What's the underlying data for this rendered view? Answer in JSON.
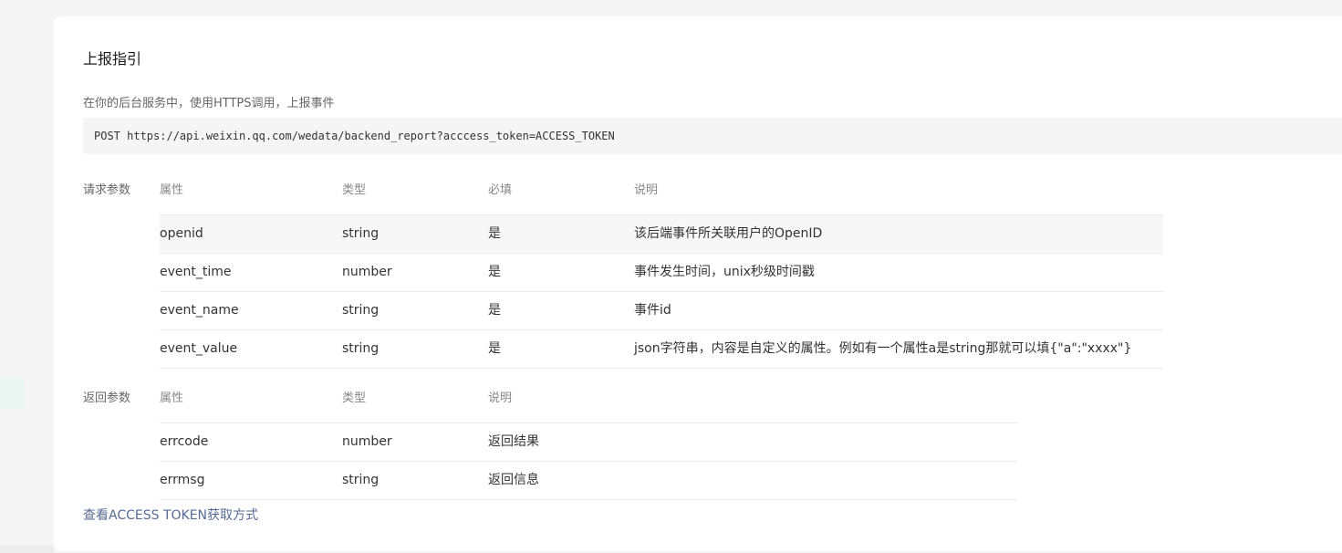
{
  "section_title": "上报指引",
  "description": "在你的后台服务中，使用HTTPS调用，上报事件",
  "request_line": "POST https://api.weixin.qq.com/wedata/backend_report?acccess_token=ACCESS_TOKEN",
  "request_params": {
    "label": "请求参数",
    "headers": [
      "属性",
      "类型",
      "必填",
      "说明"
    ],
    "rows": [
      {
        "name": "openid",
        "type": "string",
        "required": "是",
        "desc": "该后端事件所关联用户的OpenID"
      },
      {
        "name": "event_time",
        "type": "number",
        "required": "是",
        "desc": "事件发生时间，unix秒级时间戳"
      },
      {
        "name": "event_name",
        "type": "string",
        "required": "是",
        "desc": "事件id"
      },
      {
        "name": "event_value",
        "type": "string",
        "required": "是",
        "desc": "json字符串，内容是自定义的属性。例如有一个属性a是string那就可以填{\"a\":\"xxxx\"}"
      }
    ]
  },
  "response_params": {
    "label": "返回参数",
    "headers": [
      "属性",
      "类型",
      "说明"
    ],
    "rows": [
      {
        "name": "errcode",
        "type": "number",
        "desc": "返回结果"
      },
      {
        "name": "errmsg",
        "type": "string",
        "desc": "返回信息"
      }
    ]
  },
  "token_link": "查看ACCESS TOKEN获取方式",
  "colors": {
    "link": "#576b95",
    "background": "#f5f5f5",
    "card": "#ffffff",
    "highlight_row": "#f7f7f7"
  }
}
